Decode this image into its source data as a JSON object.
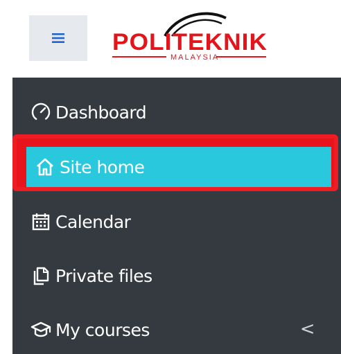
{
  "header": {
    "menu_icon": "hamburger-icon",
    "logo": {
      "text": "POLITEKNIK",
      "subtext": "MALAYSIA",
      "color": "#e3151b"
    }
  },
  "sidebar": {
    "items": [
      {
        "label": "Dashboard",
        "icon": "gauge-icon",
        "active": false
      },
      {
        "label": "Site home",
        "icon": "home-icon",
        "active": true
      },
      {
        "label": "Calendar",
        "icon": "calendar-icon",
        "active": false
      },
      {
        "label": "Private files",
        "icon": "files-icon",
        "active": false
      },
      {
        "label": "My courses",
        "icon": "graduation-cap-icon",
        "active": false,
        "chevron": "<"
      }
    ]
  },
  "colors": {
    "sidebar_bg": "#343a40",
    "active_bg": "#29c8dc",
    "highlight_border": "#ee1c23",
    "toggle_bg": "#e6e9ee"
  }
}
